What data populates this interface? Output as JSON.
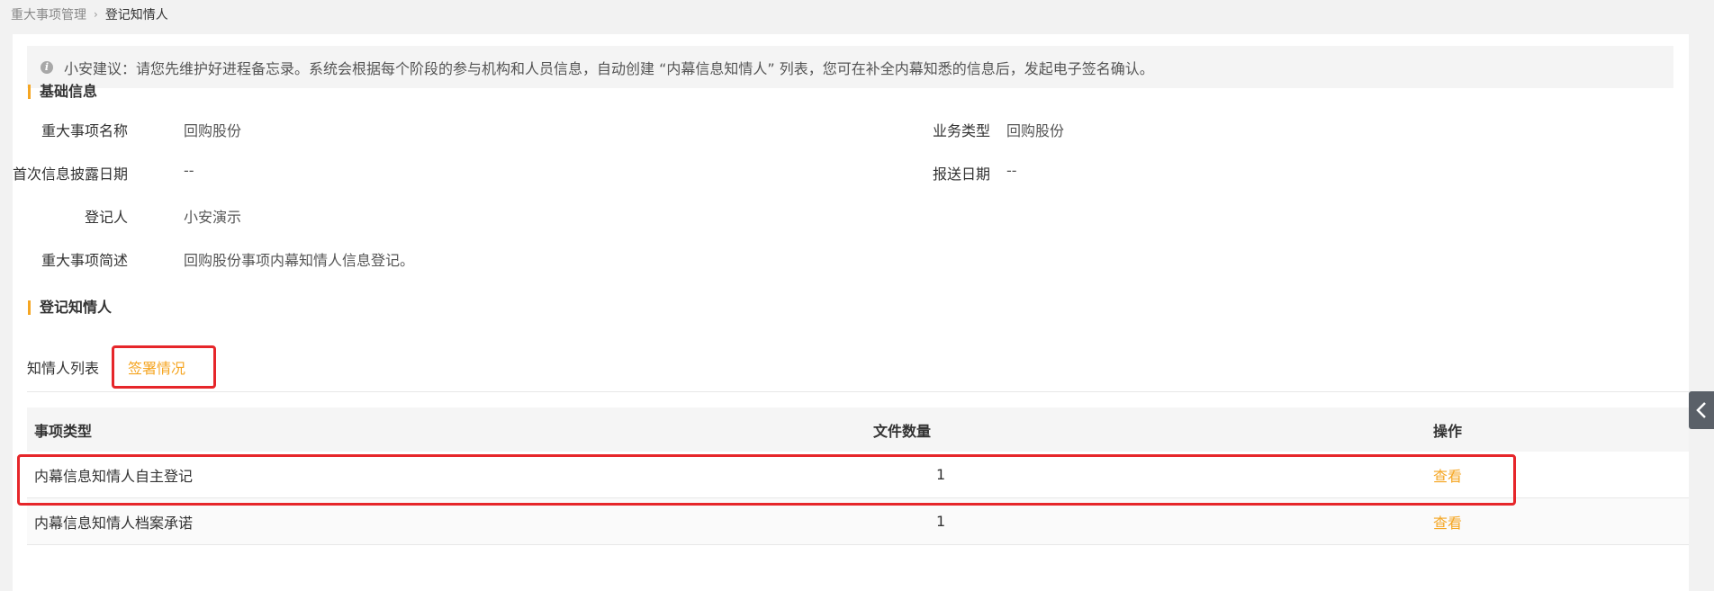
{
  "breadcrumb": {
    "parent": "重大事项管理",
    "current": "登记知情人"
  },
  "notice": {
    "text": "小安建议：请您先维护好进程备忘录。系统会根据每个阶段的参与机构和人员信息，自动创建 “内幕信息知情人” 列表，您可在补全内幕知悉的信息后，发起电子签名确认。"
  },
  "basic_info": {
    "title": "基础信息",
    "fields": {
      "event_name_label": "重大事项名称",
      "event_name_value": "回购股份",
      "business_type_label": "业务类型",
      "business_type_value": "回购股份",
      "first_disclosure_label": "首次信息披露日期",
      "first_disclosure_value": "--",
      "report_date_label": "报送日期",
      "report_date_value": "--",
      "registrant_label": "登记人",
      "registrant_value": "小安演示",
      "summary_label": "重大事项简述",
      "summary_value": "回购股份事项内幕知情人信息登记。"
    }
  },
  "register": {
    "title": "登记知情人",
    "tabs": [
      {
        "label": "知情人列表",
        "active": false
      },
      {
        "label": "签署情况",
        "active": true
      }
    ]
  },
  "table": {
    "headers": [
      "事项类型",
      "文件数量",
      "操作"
    ],
    "rows": [
      {
        "type": "内幕信息知情人自主登记",
        "count": "1",
        "action": "查看"
      },
      {
        "type": "内幕信息知情人档案承诺",
        "count": "1",
        "action": "查看"
      }
    ]
  },
  "colors": {
    "accent": "#f5a623",
    "highlight": "#e6262a"
  }
}
